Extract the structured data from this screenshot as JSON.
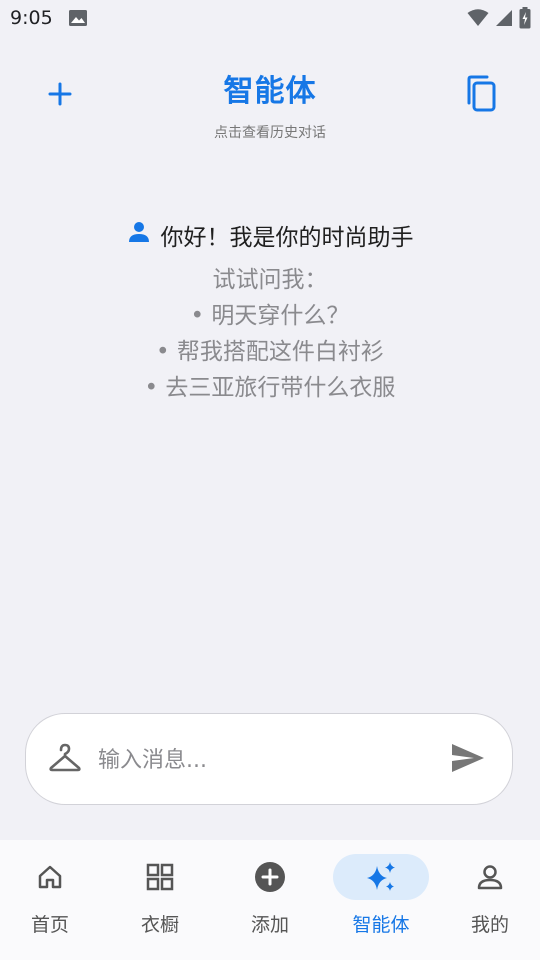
{
  "status_bar": {
    "time": "9:05",
    "icons": [
      "image-icon",
      "wifi-icon",
      "cell-signal-icon",
      "battery-charging-icon"
    ]
  },
  "header": {
    "title": "智能体",
    "subtitle": "点击查看历史对话",
    "new_chat_icon": "plus-icon",
    "history_icon": "copy-icon"
  },
  "welcome": {
    "greeting": "你好！我是你的时尚助手",
    "hint_title": "试试问我：",
    "hints": [
      "• 明天穿什么？",
      "• 帮我搭配这件白衬衫",
      "• 去三亚旅行带什么衣服"
    ]
  },
  "input": {
    "placeholder": "输入消息...",
    "value": "",
    "left_icon": "hanger-icon",
    "send_icon": "send-icon"
  },
  "bottom_nav": {
    "items": [
      {
        "label": "首页",
        "icon": "home-icon",
        "active": false
      },
      {
        "label": "衣橱",
        "icon": "grid-icon",
        "active": false
      },
      {
        "label": "添加",
        "icon": "add-circle-icon",
        "active": false
      },
      {
        "label": "智能体",
        "icon": "sparkle-icon",
        "active": true
      },
      {
        "label": "我的",
        "icon": "person-icon",
        "active": false
      }
    ]
  },
  "colors": {
    "accent": "#1677E6",
    "background": "#F1F1F6",
    "active_nav_bg": "#DCEBFB",
    "hint_text": "#8a8a8e"
  }
}
